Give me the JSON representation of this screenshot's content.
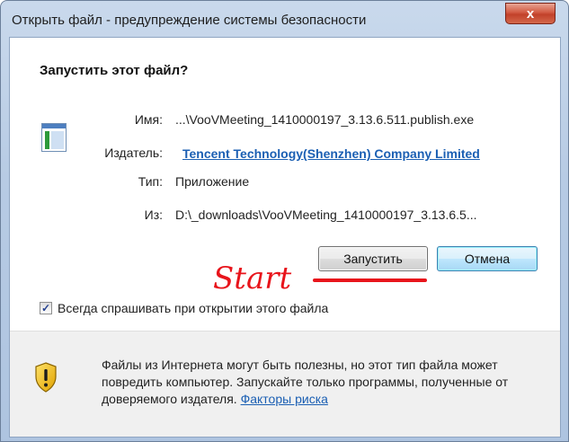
{
  "window": {
    "title": "Открыть файл - предупреждение системы безопасности",
    "close_label": "x"
  },
  "dialog": {
    "heading": "Запустить этот файл?",
    "details": [
      {
        "label": "Имя:",
        "value": "...\\VooVMeeting_1410000197_3.13.6.511.publish.exe"
      },
      {
        "label": "Издатель:",
        "value": "Tencent Technology(Shenzhen) Company Limited"
      },
      {
        "label": "Тип:",
        "value": "Приложение"
      },
      {
        "label": "Из:",
        "value": "D:\\_downloads\\VooVMeeting_1410000197_3.13.6.5..."
      }
    ],
    "run_button": "Запустить",
    "cancel_button": "Отмена",
    "checkbox_label": "Всегда спрашивать при открытии этого файла",
    "checkbox_checked": true,
    "checkbox_mark": "✓"
  },
  "annotation": {
    "text": "Start",
    "color": "#e8141b"
  },
  "footer": {
    "warning_text": "Файлы из Интернета могут быть полезны, но этот тип файла может повредить компьютер. Запускайте только программы, полученные от доверяемого издателя.",
    "risk_link": "Факторы риска"
  },
  "icons": [
    "application-icon",
    "security-warning-shield-icon",
    "close-icon",
    "checkmark-icon"
  ],
  "colors": {
    "link": "#1b5fb3",
    "shield_yellow": "#f5c518",
    "close_button": "#c1412a"
  }
}
